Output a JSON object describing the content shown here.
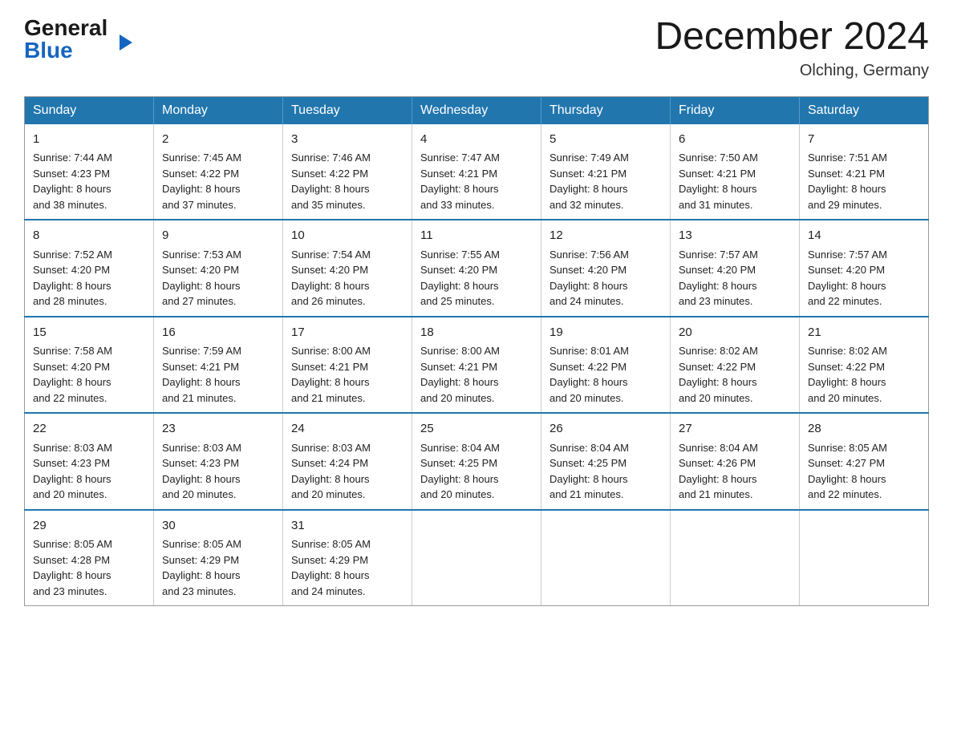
{
  "logo": {
    "general": "General",
    "arrow": "▶",
    "blue": "Blue"
  },
  "header": {
    "month_title": "December 2024",
    "location": "Olching, Germany"
  },
  "weekdays": [
    "Sunday",
    "Monday",
    "Tuesday",
    "Wednesday",
    "Thursday",
    "Friday",
    "Saturday"
  ],
  "weeks": [
    [
      {
        "day": "1",
        "sunrise": "7:44 AM",
        "sunset": "4:23 PM",
        "daylight": "8 hours and 38 minutes."
      },
      {
        "day": "2",
        "sunrise": "7:45 AM",
        "sunset": "4:22 PM",
        "daylight": "8 hours and 37 minutes."
      },
      {
        "day": "3",
        "sunrise": "7:46 AM",
        "sunset": "4:22 PM",
        "daylight": "8 hours and 35 minutes."
      },
      {
        "day": "4",
        "sunrise": "7:47 AM",
        "sunset": "4:21 PM",
        "daylight": "8 hours and 33 minutes."
      },
      {
        "day": "5",
        "sunrise": "7:49 AM",
        "sunset": "4:21 PM",
        "daylight": "8 hours and 32 minutes."
      },
      {
        "day": "6",
        "sunrise": "7:50 AM",
        "sunset": "4:21 PM",
        "daylight": "8 hours and 31 minutes."
      },
      {
        "day": "7",
        "sunrise": "7:51 AM",
        "sunset": "4:21 PM",
        "daylight": "8 hours and 29 minutes."
      }
    ],
    [
      {
        "day": "8",
        "sunrise": "7:52 AM",
        "sunset": "4:20 PM",
        "daylight": "8 hours and 28 minutes."
      },
      {
        "day": "9",
        "sunrise": "7:53 AM",
        "sunset": "4:20 PM",
        "daylight": "8 hours and 27 minutes."
      },
      {
        "day": "10",
        "sunrise": "7:54 AM",
        "sunset": "4:20 PM",
        "daylight": "8 hours and 26 minutes."
      },
      {
        "day": "11",
        "sunrise": "7:55 AM",
        "sunset": "4:20 PM",
        "daylight": "8 hours and 25 minutes."
      },
      {
        "day": "12",
        "sunrise": "7:56 AM",
        "sunset": "4:20 PM",
        "daylight": "8 hours and 24 minutes."
      },
      {
        "day": "13",
        "sunrise": "7:57 AM",
        "sunset": "4:20 PM",
        "daylight": "8 hours and 23 minutes."
      },
      {
        "day": "14",
        "sunrise": "7:57 AM",
        "sunset": "4:20 PM",
        "daylight": "8 hours and 22 minutes."
      }
    ],
    [
      {
        "day": "15",
        "sunrise": "7:58 AM",
        "sunset": "4:20 PM",
        "daylight": "8 hours and 22 minutes."
      },
      {
        "day": "16",
        "sunrise": "7:59 AM",
        "sunset": "4:21 PM",
        "daylight": "8 hours and 21 minutes."
      },
      {
        "day": "17",
        "sunrise": "8:00 AM",
        "sunset": "4:21 PM",
        "daylight": "8 hours and 21 minutes."
      },
      {
        "day": "18",
        "sunrise": "8:00 AM",
        "sunset": "4:21 PM",
        "daylight": "8 hours and 20 minutes."
      },
      {
        "day": "19",
        "sunrise": "8:01 AM",
        "sunset": "4:22 PM",
        "daylight": "8 hours and 20 minutes."
      },
      {
        "day": "20",
        "sunrise": "8:02 AM",
        "sunset": "4:22 PM",
        "daylight": "8 hours and 20 minutes."
      },
      {
        "day": "21",
        "sunrise": "8:02 AM",
        "sunset": "4:22 PM",
        "daylight": "8 hours and 20 minutes."
      }
    ],
    [
      {
        "day": "22",
        "sunrise": "8:03 AM",
        "sunset": "4:23 PM",
        "daylight": "8 hours and 20 minutes."
      },
      {
        "day": "23",
        "sunrise": "8:03 AM",
        "sunset": "4:23 PM",
        "daylight": "8 hours and 20 minutes."
      },
      {
        "day": "24",
        "sunrise": "8:03 AM",
        "sunset": "4:24 PM",
        "daylight": "8 hours and 20 minutes."
      },
      {
        "day": "25",
        "sunrise": "8:04 AM",
        "sunset": "4:25 PM",
        "daylight": "8 hours and 20 minutes."
      },
      {
        "day": "26",
        "sunrise": "8:04 AM",
        "sunset": "4:25 PM",
        "daylight": "8 hours and 21 minutes."
      },
      {
        "day": "27",
        "sunrise": "8:04 AM",
        "sunset": "4:26 PM",
        "daylight": "8 hours and 21 minutes."
      },
      {
        "day": "28",
        "sunrise": "8:05 AM",
        "sunset": "4:27 PM",
        "daylight": "8 hours and 22 minutes."
      }
    ],
    [
      {
        "day": "29",
        "sunrise": "8:05 AM",
        "sunset": "4:28 PM",
        "daylight": "8 hours and 23 minutes."
      },
      {
        "day": "30",
        "sunrise": "8:05 AM",
        "sunset": "4:29 PM",
        "daylight": "8 hours and 23 minutes."
      },
      {
        "day": "31",
        "sunrise": "8:05 AM",
        "sunset": "4:29 PM",
        "daylight": "8 hours and 24 minutes."
      },
      null,
      null,
      null,
      null
    ]
  ],
  "labels": {
    "sunrise": "Sunrise:",
    "sunset": "Sunset:",
    "daylight": "Daylight:"
  }
}
